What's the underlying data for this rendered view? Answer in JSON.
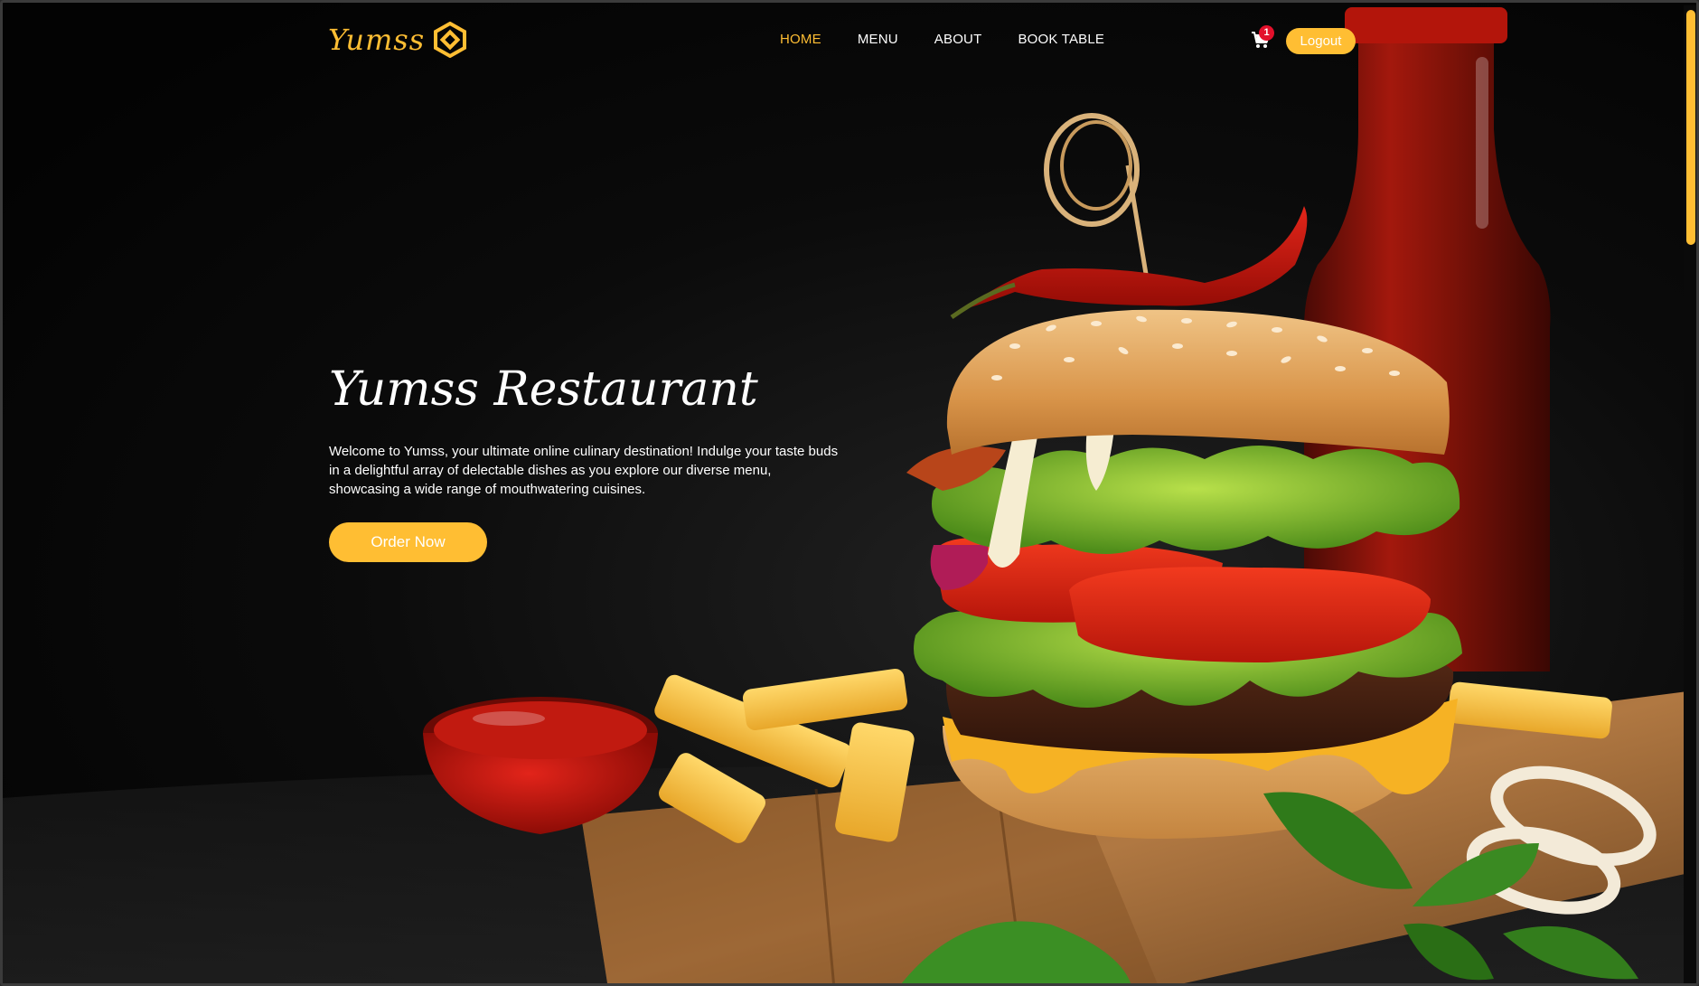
{
  "brand": {
    "name": "Yumss",
    "accent_color": "#ffbe33",
    "logo_icon": "hexagon-swirl-icon"
  },
  "nav": {
    "items": [
      {
        "label": "HOME",
        "active": true
      },
      {
        "label": "MENU",
        "active": false
      },
      {
        "label": "ABOUT",
        "active": false
      },
      {
        "label": "BOOK TABLE",
        "active": false
      }
    ],
    "cart_icon": "cart-icon",
    "cart_count": "1",
    "logout_label": "Logout"
  },
  "hero": {
    "title": "Yumss Restaurant",
    "description": "Welcome to Yumss, your ultimate online culinary destination! Indulge your taste buds in a delightful array of delectable dishes as you explore our diverse menu, showcasing a wide range of mouthwatering cuisines.",
    "cta_label": "Order Now",
    "image": "burger-fries-ketchup-photo"
  }
}
